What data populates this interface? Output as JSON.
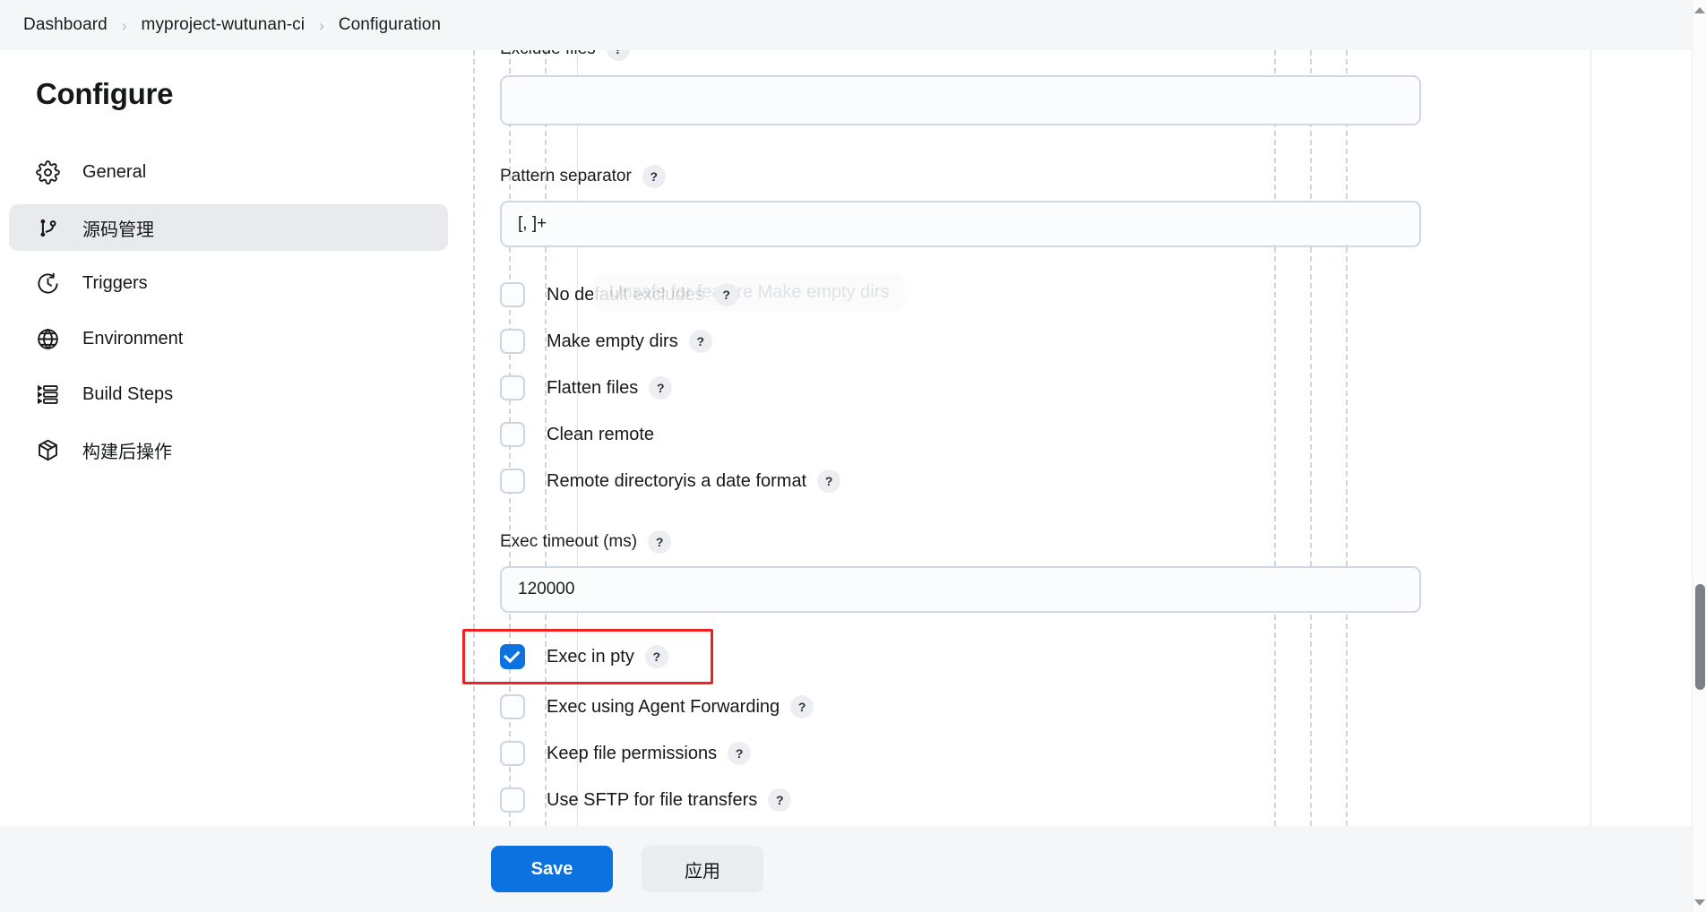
{
  "breadcrumb": {
    "items": [
      "Dashboard",
      "myproject-wutunan-ci",
      "Configuration"
    ],
    "separator": "›"
  },
  "sidebar": {
    "title": "Configure",
    "items": [
      {
        "label": "General",
        "icon": "gear-icon",
        "active": false
      },
      {
        "label": "源码管理",
        "icon": "branch-icon",
        "active": true
      },
      {
        "label": "Triggers",
        "icon": "clock-icon",
        "active": false
      },
      {
        "label": "Environment",
        "icon": "globe-icon",
        "active": false
      },
      {
        "label": "Build Steps",
        "icon": "steps-icon",
        "active": false
      },
      {
        "label": "构建后操作",
        "icon": "package-icon",
        "active": false
      }
    ]
  },
  "form": {
    "help_glyph": "?",
    "exclude_files": {
      "label": "Exclude files",
      "value": "",
      "placeholder": ""
    },
    "pattern_separator": {
      "label": "Pattern separator",
      "value": "[, ]+",
      "placeholder": ""
    },
    "exec_timeout": {
      "label": "Exec timeout (ms)",
      "value": "120000",
      "placeholder": ""
    },
    "checkboxes_group_1": [
      {
        "label": "No default excludes",
        "checked": false,
        "has_help": true
      },
      {
        "label": "Make empty dirs",
        "checked": false,
        "has_help": true
      },
      {
        "label": "Flatten files",
        "checked": false,
        "has_help": true
      },
      {
        "label": "Clean remote",
        "checked": false,
        "has_help": false
      },
      {
        "label": "Remote directoryis a date format",
        "checked": false,
        "has_help": true
      }
    ],
    "checkboxes_group_2": [
      {
        "label": "Exec in pty",
        "checked": true,
        "has_help": true,
        "highlighted": true
      },
      {
        "label": "Exec using Agent Forwarding",
        "checked": false,
        "has_help": true,
        "highlighted": false
      },
      {
        "label": "Keep file permissions",
        "checked": false,
        "has_help": true,
        "highlighted": false
      },
      {
        "label": "Use SFTP for file transfers",
        "checked": false,
        "has_help": true,
        "highlighted": false
      }
    ],
    "ghost_tooltip": "Unsafe for feature Make empty dirs"
  },
  "footer": {
    "save_label": "Save",
    "apply_label": "应用"
  },
  "colors": {
    "accent": "#0b72e0",
    "highlight": "#ee2222",
    "header_bg": "#f5f6f8",
    "active_nav_bg": "#e9eaee"
  }
}
